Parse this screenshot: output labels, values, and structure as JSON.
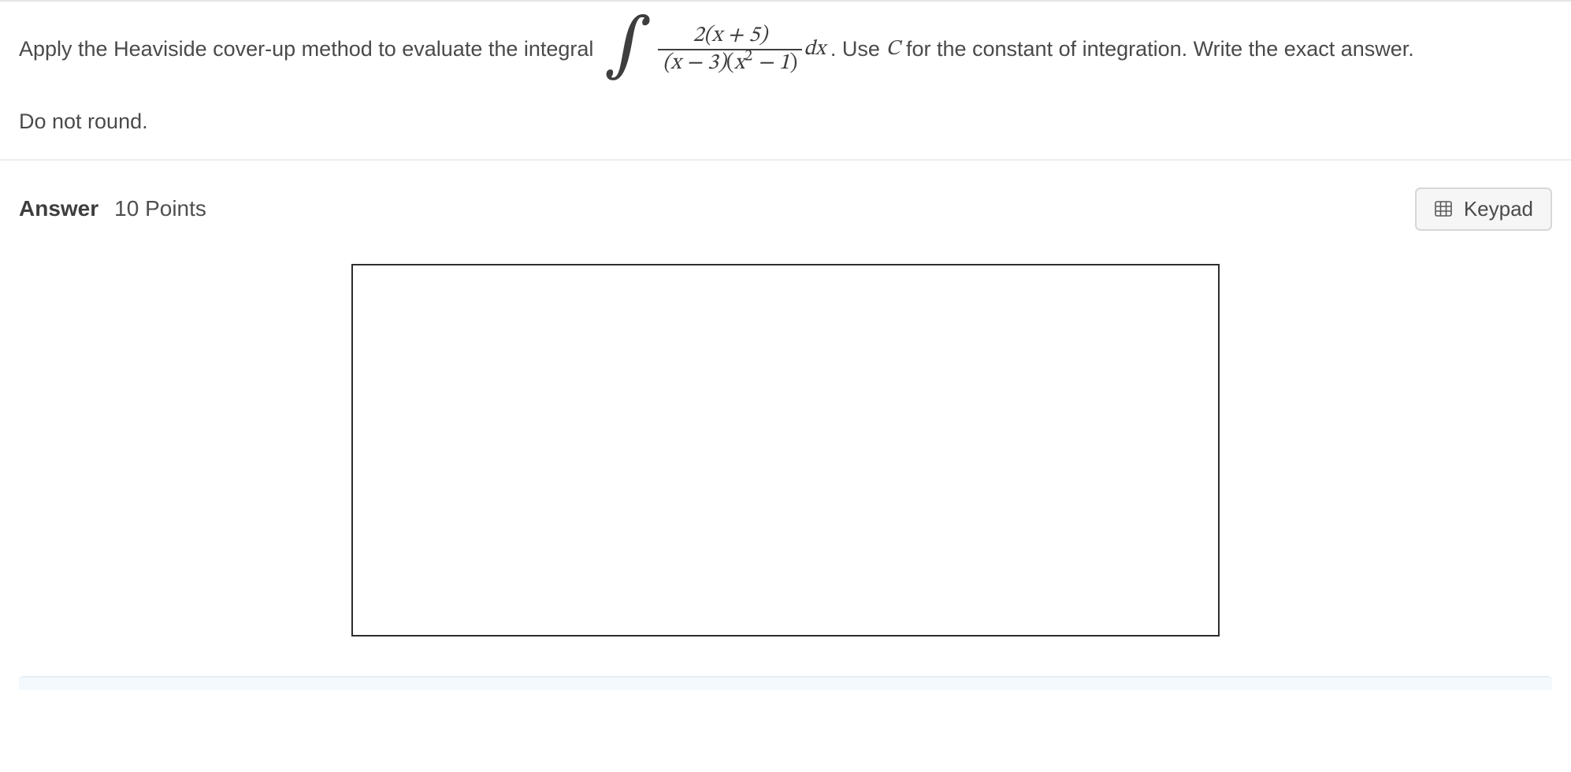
{
  "question": {
    "lead_text": "Apply the Heaviside cover-up method to evaluate the integral ",
    "integral": {
      "numerator": "2(x + 5)",
      "denom_left": "(x − 3)",
      "denom_right_base": "x",
      "denom_right_exp": "2",
      "denom_right_tail": " − 1",
      "differential": "dx"
    },
    "after_integral_1": ". Use ",
    "constant_symbol": "C",
    "after_integral_2": " for the constant of integration. Write the exact answer.",
    "second_line": "Do not round."
  },
  "answer_section": {
    "label": "Answer",
    "points": "10 Points",
    "keypad_button": "Keypad"
  }
}
